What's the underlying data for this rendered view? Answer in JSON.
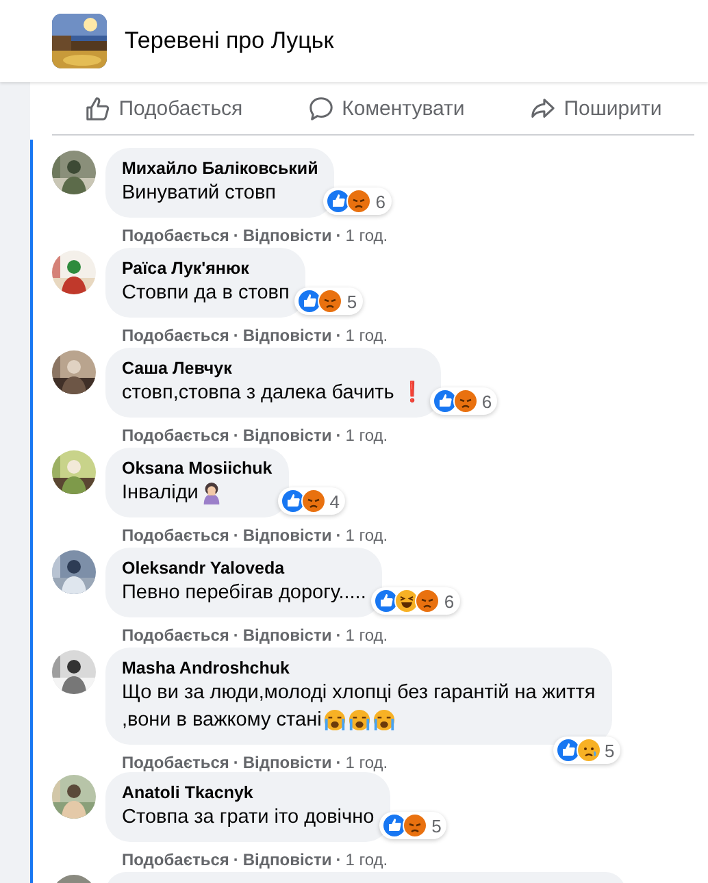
{
  "page": {
    "title": "Теревені про Луцьк"
  },
  "actions": [
    {
      "kind": "like",
      "label": "Подобається"
    },
    {
      "kind": "comment",
      "label": "Коментувати"
    },
    {
      "kind": "share",
      "label": "Поширити"
    }
  ],
  "comments": [
    {
      "author": "Михайло Баліковський",
      "text": "Винуватий стовп",
      "reactions": [
        {
          "kind": "like"
        },
        {
          "kind": "angry"
        }
      ],
      "reaction_count": "6",
      "meta": [
        "Подобається",
        "·",
        "Відповісти",
        "·",
        "1 год."
      ]
    },
    {
      "author": "Раїса Лук'янюк",
      "text": "Стовпи да в стовп",
      "reactions": [
        {
          "kind": "like"
        },
        {
          "kind": "angry"
        }
      ],
      "reaction_count": "5",
      "meta": [
        "Подобається",
        "·",
        "Відповісти",
        "·",
        "1 год."
      ]
    },
    {
      "author": "Саша Левчук",
      "text": "стовп,стовпа з далека бачить ❗",
      "reactions": [
        {
          "kind": "like"
        },
        {
          "kind": "angry"
        }
      ],
      "reaction_count": "6",
      "meta": [
        "Подобається",
        "·",
        "Відповісти",
        "·",
        "1 год."
      ]
    },
    {
      "author": "Oksana Mosiichuk",
      "text": "Інваліди",
      "emojis": [
        {
          "kind": "facepalm"
        }
      ],
      "reactions": [
        {
          "kind": "like"
        },
        {
          "kind": "angry"
        }
      ],
      "reaction_count": "4",
      "meta": [
        "Подобається",
        "·",
        "Відповісти",
        "·",
        "1 год."
      ]
    },
    {
      "author": "Oleksandr Yaloveda",
      "text": "Певно перебігав дорогу.....",
      "reactions": [
        {
          "kind": "like"
        },
        {
          "kind": "haha"
        },
        {
          "kind": "angry"
        }
      ],
      "reaction_count": "6",
      "meta": [
        "Подобається",
        "·",
        "Відповісти",
        "·",
        "1 год."
      ]
    },
    {
      "author": "Masha Androshchuk",
      "text": "Що ви за люди,молоді хлопці без гарантій на життя",
      "text_end": ",вони в важкому стані",
      "emojis": [
        {
          "kind": "crying"
        },
        {
          "kind": "crying"
        },
        {
          "kind": "crying"
        }
      ],
      "reactions": [
        {
          "kind": "like"
        },
        {
          "kind": "sad"
        }
      ],
      "reaction_count": "5",
      "reactions_below": true,
      "meta": [
        "Подобається",
        "·",
        "Відповісти",
        "·",
        "1 год."
      ]
    },
    {
      "author": "Anatoli Tkacnyk",
      "text": "Стовпа за грати іто довічно",
      "reactions": [
        {
          "kind": "like"
        },
        {
          "kind": "angry"
        }
      ],
      "reaction_count": "5",
      "meta": [
        "Подобається",
        "·",
        "Відповісти",
        "·",
        "1 год."
      ]
    }
  ],
  "more_below": true
}
